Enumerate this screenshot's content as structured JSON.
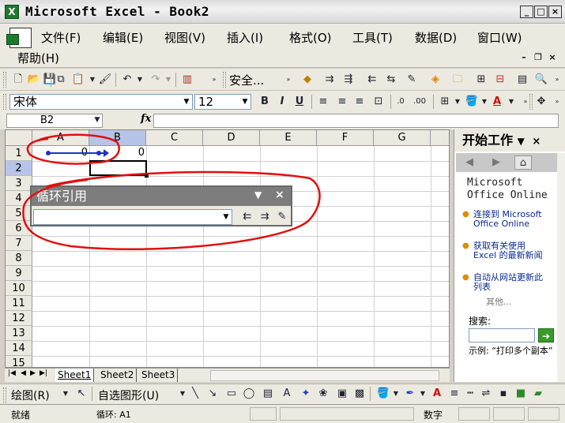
{
  "window": {
    "title": "Microsoft Excel - Book2",
    "min_label": "_",
    "max_label": "□",
    "close_label": "×"
  },
  "menu": {
    "items": [
      "文件(F)",
      "编辑(E)",
      "视图(V)",
      "插入(I)",
      "格式(O)",
      "工具(T)",
      "数据(D)",
      "窗口(W)",
      "帮助(H)"
    ]
  },
  "toolbar": {
    "security_label": "安全...",
    "font_name": "宋体",
    "font_size": "12",
    "bold": "B",
    "italic": "I",
    "underline": "U"
  },
  "formula_bar": {
    "name_box": "B2",
    "fx": "fx",
    "formula": ""
  },
  "grid": {
    "columns": [
      "A",
      "B",
      "C",
      "D",
      "E",
      "F",
      "G"
    ],
    "rows": [
      "1",
      "2",
      "3",
      "4",
      "5",
      "6",
      "7",
      "8",
      "9",
      "10",
      "11",
      "12",
      "13",
      "14",
      "15"
    ],
    "cells": {
      "A1": "0",
      "B1": "0"
    },
    "selected_cell": "B2"
  },
  "circular_toolbar": {
    "title": "循环引用",
    "combo_value": ""
  },
  "sheets": {
    "tabs": [
      "Sheet1",
      "Sheet2",
      "Sheet3"
    ],
    "active": "Sheet1"
  },
  "task_pane": {
    "title": "开始工作",
    "brand_line1": "Microsoft",
    "brand_line2": "Office Online",
    "links": [
      "连接到 Microsoft Office Online",
      "获取有关使用 Excel 的最新新闻",
      "自动从网站更新此列表"
    ],
    "more": "其他...",
    "search_label": "搜索:",
    "example": "示例: “打印多个副本”"
  },
  "drawing": {
    "draw_label": "绘图(R)",
    "autoshapes_label": "自选图形(U)"
  },
  "status": {
    "ready": "就绪",
    "circular": "循环: A1",
    "mode": "数字"
  },
  "colors": {
    "annotation": "#e01010",
    "tracer": "#2030c0",
    "selection_header": "#b6c4e8"
  }
}
